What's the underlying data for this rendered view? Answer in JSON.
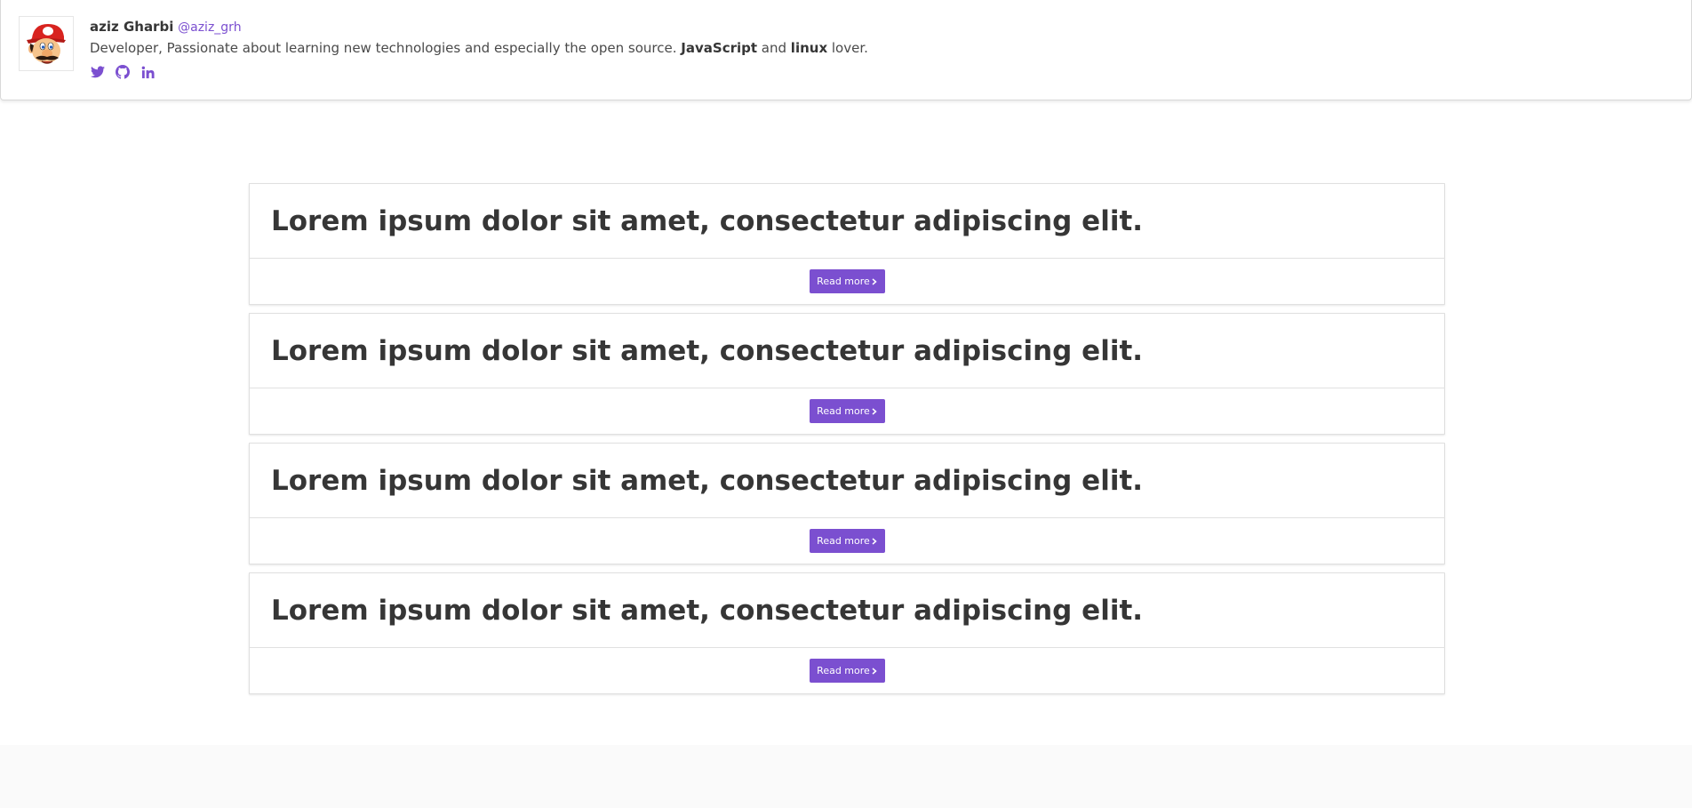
{
  "header": {
    "name": "aziz Gharbi",
    "handle": "@aziz_grh",
    "bio_prefix": "Developer, Passionate about learning new technologies and especially the open source. ",
    "bio_strong1": "JavaScript",
    "bio_middle": " and ",
    "bio_strong2": "linux",
    "bio_suffix": " lover.",
    "socials": [
      {
        "icon": "twitter-icon"
      },
      {
        "icon": "github-icon"
      },
      {
        "icon": "linkedin-icon"
      }
    ]
  },
  "posts": [
    {
      "title": "Lorem ipsum dolor sit amet, consectetur adipiscing elit.",
      "button": "Read more"
    },
    {
      "title": "Lorem ipsum dolor sit amet, consectetur adipiscing elit.",
      "button": "Read more"
    },
    {
      "title": "Lorem ipsum dolor sit amet, consectetur adipiscing elit.",
      "button": "Read more"
    },
    {
      "title": "Lorem ipsum dolor sit amet, consectetur adipiscing elit.",
      "button": "Read more"
    }
  ],
  "colors": {
    "accent": "#7b4fd0",
    "text": "#363636",
    "footer_bg": "#fafafa"
  }
}
